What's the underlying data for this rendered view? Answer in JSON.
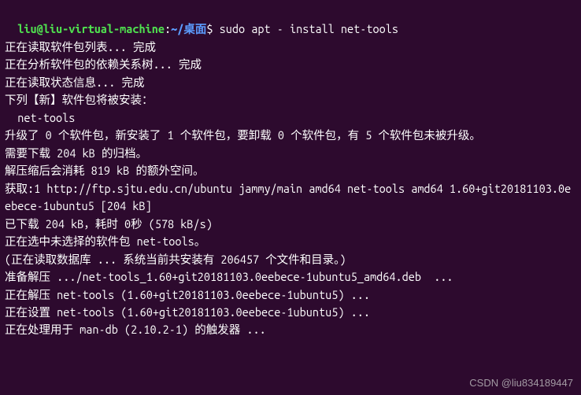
{
  "prompt": {
    "user_host": "liu@liu-virtual-machine",
    "colon": ":",
    "path_tilde": "~/",
    "path_dir": "桌面",
    "dollar": "$ ",
    "command": "sudo apt - install net-tools"
  },
  "output": {
    "l1": "正在读取软件包列表... 完成",
    "l2": "正在分析软件包的依赖关系树... 完成",
    "l3": "正在读取状态信息... 完成",
    "l4": "下列【新】软件包将被安装：",
    "l5": "  net-tools",
    "l6": "升级了 0 个软件包，新安装了 1 个软件包，要卸载 0 个软件包，有 5 个软件包未被升级。",
    "l7": "需要下载 204 kB 的归档。",
    "l8": "解压缩后会消耗 819 kB 的额外空间。",
    "l9": "获取:1 http://ftp.sjtu.edu.cn/ubuntu jammy/main amd64 net-tools amd64 1.60+git20181103.0eebece-1ubuntu5 [204 kB]",
    "l10": "已下载 204 kB，耗时 0秒 (578 kB/s)",
    "l11": "正在选中未选择的软件包 net-tools。",
    "l12": "(正在读取数据库 ... 系统当前共安装有 206457 个文件和目录。)",
    "l13": "准备解压 .../net-tools_1.60+git20181103.0eebece-1ubuntu5_amd64.deb  ...",
    "l14": "正在解压 net-tools (1.60+git20181103.0eebece-1ubuntu5) ...",
    "l15": "正在设置 net-tools (1.60+git20181103.0eebece-1ubuntu5) ...",
    "l16": "正在处理用于 man-db (2.10.2-1) 的触发器 ..."
  },
  "watermark": "CSDN @liu834189447"
}
